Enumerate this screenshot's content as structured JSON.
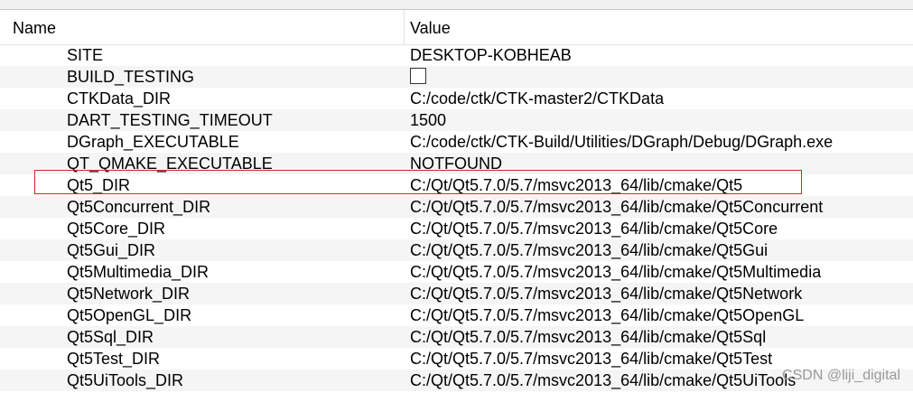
{
  "header": {
    "name": "Name",
    "value": "Value"
  },
  "rows": [
    {
      "name": "SITE",
      "value": "DESKTOP-KOBHEAB"
    },
    {
      "name": "BUILD_TESTING",
      "value": "",
      "checkbox": true
    },
    {
      "name": "CTKData_DIR",
      "value": "C:/code/ctk/CTK-master2/CTKData"
    },
    {
      "name": "DART_TESTING_TIMEOUT",
      "value": "1500"
    },
    {
      "name": "DGraph_EXECUTABLE",
      "value": "C:/code/ctk/CTK-Build/Utilities/DGraph/Debug/DGraph.exe"
    },
    {
      "name": "QT_QMAKE_EXECUTABLE",
      "value": "NOTFOUND"
    },
    {
      "name": "Qt5_DIR",
      "value": "C:/Qt/Qt5.7.0/5.7/msvc2013_64/lib/cmake/Qt5"
    },
    {
      "name": "Qt5Concurrent_DIR",
      "value": "C:/Qt/Qt5.7.0/5.7/msvc2013_64/lib/cmake/Qt5Concurrent"
    },
    {
      "name": "Qt5Core_DIR",
      "value": "C:/Qt/Qt5.7.0/5.7/msvc2013_64/lib/cmake/Qt5Core"
    },
    {
      "name": "Qt5Gui_DIR",
      "value": "C:/Qt/Qt5.7.0/5.7/msvc2013_64/lib/cmake/Qt5Gui"
    },
    {
      "name": "Qt5Multimedia_DIR",
      "value": "C:/Qt/Qt5.7.0/5.7/msvc2013_64/lib/cmake/Qt5Multimedia"
    },
    {
      "name": "Qt5Network_DIR",
      "value": "C:/Qt/Qt5.7.0/5.7/msvc2013_64/lib/cmake/Qt5Network"
    },
    {
      "name": "Qt5OpenGL_DIR",
      "value": "C:/Qt/Qt5.7.0/5.7/msvc2013_64/lib/cmake/Qt5OpenGL"
    },
    {
      "name": "Qt5Sql_DIR",
      "value": "C:/Qt/Qt5.7.0/5.7/msvc2013_64/lib/cmake/Qt5Sql"
    },
    {
      "name": "Qt5Test_DIR",
      "value": "C:/Qt/Qt5.7.0/5.7/msvc2013_64/lib/cmake/Qt5Test"
    },
    {
      "name": "Qt5UiTools_DIR",
      "value": "C:/Qt/Qt5.7.0/5.7/msvc2013_64/lib/cmake/Qt5UiTools"
    }
  ],
  "watermark": "CSDN @liji_digital",
  "colors": {
    "highlight": "#d12a2a",
    "alt_row": "#f5f5f5"
  }
}
